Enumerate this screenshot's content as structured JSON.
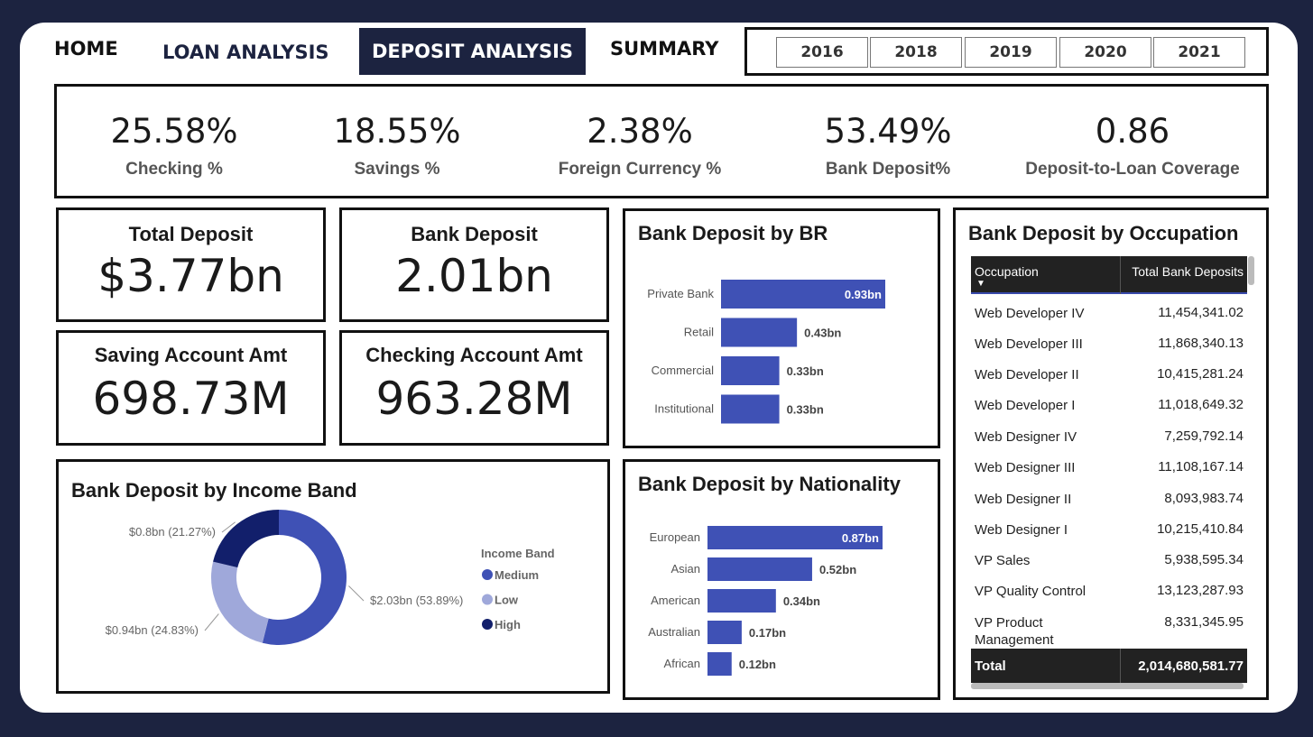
{
  "nav": {
    "home": "HOME",
    "loan": "LOAN ANALYSIS",
    "deposit": "DEPOSIT ANALYSIS",
    "summary": "SUMMARY"
  },
  "years": [
    "2016",
    "2018",
    "2019",
    "2020",
    "2021"
  ],
  "kpis": [
    {
      "value": "25.58%",
      "label": "Checking %"
    },
    {
      "value": "18.55%",
      "label": "Savings %"
    },
    {
      "value": "2.38%",
      "label": "Foreign Currency %"
    },
    {
      "value": "53.49%",
      "label": "Bank Deposit%"
    },
    {
      "value": "0.86",
      "label": "Deposit-to-Loan Coverage"
    }
  ],
  "cards": {
    "total_deposit": {
      "title": "Total Deposit",
      "value": "$3.77bn"
    },
    "bank_deposit": {
      "title": "Bank Deposit",
      "value": "2.01bn"
    },
    "saving_amt": {
      "title": "Saving Account Amt",
      "value": "698.73M"
    },
    "checking_amt": {
      "title": "Checking Account Amt",
      "value": "963.28M"
    }
  },
  "colors": {
    "navy": "#1c2340",
    "bar": "#3f51b5",
    "medium": "#3f51b5",
    "low": "#9fa8da",
    "high": "#121f6b"
  },
  "chart_data": [
    {
      "type": "bar",
      "orientation": "horizontal",
      "title": "Bank Deposit by BR",
      "categories": [
        "Private Bank",
        "Retail",
        "Commercial",
        "Institutional"
      ],
      "values": [
        0.93,
        0.43,
        0.33,
        0.33
      ],
      "labels": [
        "0.93bn",
        "0.43bn",
        "0.33bn",
        "0.33bn"
      ],
      "xmax": 0.93
    },
    {
      "type": "bar",
      "orientation": "horizontal",
      "title": "Bank Deposit by Nationality",
      "categories": [
        "European",
        "Asian",
        "American",
        "Australian",
        "African"
      ],
      "values": [
        0.87,
        0.52,
        0.34,
        0.17,
        0.12
      ],
      "labels": [
        "0.87bn",
        "0.52bn",
        "0.34bn",
        "0.17bn",
        "0.12bn"
      ],
      "xmax": 0.87
    },
    {
      "type": "pie",
      "donut": true,
      "title": "Bank Deposit by Income Band",
      "legend_title": "Income Band",
      "slices": [
        {
          "name": "Medium",
          "value": 2.03,
          "percent": 53.89,
          "label": "$2.03bn (53.89%)"
        },
        {
          "name": "Low",
          "value": 0.94,
          "percent": 24.83,
          "label": "$0.94bn (24.83%)"
        },
        {
          "name": "High",
          "value": 0.8,
          "percent": 21.27,
          "label": "$0.8bn (21.27%)"
        }
      ],
      "legend_position": "right"
    },
    {
      "type": "table",
      "title": "Bank Deposit by Occupation",
      "columns": [
        "Occupation",
        "Total Bank Deposits"
      ],
      "rows": [
        [
          "Web Developer IV",
          "11,454,341.02"
        ],
        [
          "Web Developer III",
          "11,868,340.13"
        ],
        [
          "Web Developer II",
          "10,415,281.24"
        ],
        [
          "Web Developer I",
          "11,018,649.32"
        ],
        [
          "Web Designer IV",
          "7,259,792.14"
        ],
        [
          "Web Designer III",
          "11,108,167.14"
        ],
        [
          "Web Designer II",
          "8,093,983.74"
        ],
        [
          "Web Designer I",
          "10,215,410.84"
        ],
        [
          "VP Sales",
          "5,938,595.34"
        ],
        [
          "VP Quality Control",
          "13,123,287.93"
        ],
        [
          "VP Product Management",
          "8,331,345.95"
        ]
      ],
      "total_label": "Total",
      "total_value": "2,014,680,581.77"
    }
  ]
}
